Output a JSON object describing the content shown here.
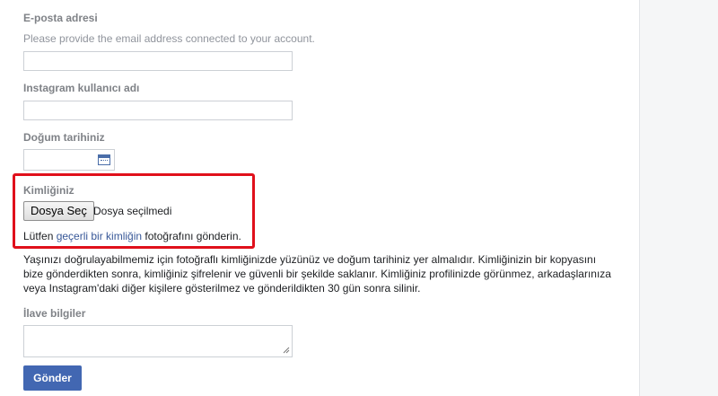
{
  "form": {
    "email": {
      "label": "E-posta adresi",
      "help": "Please provide the email address connected to your account.",
      "value": ""
    },
    "instagram": {
      "label": "Instagram kullanıcı adı",
      "value": ""
    },
    "birthdate": {
      "label": "Doğum tarihiniz",
      "value": ""
    },
    "identity": {
      "label": "Kimliğiniz",
      "choose_button": "Dosya Seç",
      "file_status": "Dosya seçilmedi",
      "upload_prefix": "Lütfen ",
      "upload_link": "geçerli bir kimliğin",
      "upload_suffix": " fotoğrafını gönderin."
    },
    "description": "Yaşınızı doğrulayabilmemiz için fotoğraflı kimliğinizde yüzünüz ve doğum tarihiniz yer almalıdır. Kimliğinizin bir kopyasını bize gönderdikten sonra, kimliğiniz şifrelenir ve güvenli bir şekilde saklanır. Kimliğiniz profilinizde görünmez, arkadaşlarınıza veya Instagram'daki diğer kişilere gösterilmez ve gönderildikten 30 gün sonra silinir.",
    "additional": {
      "label": "İlave bilgiler",
      "value": ""
    },
    "submit_label": "Gönder"
  },
  "colors": {
    "accent": "#4267b2",
    "link": "#385898",
    "highlight": "#e0101b",
    "label": "#7f8287"
  },
  "icons": {
    "date_picker": "calendar-icon",
    "textarea_grip": "resize-grip-icon"
  }
}
